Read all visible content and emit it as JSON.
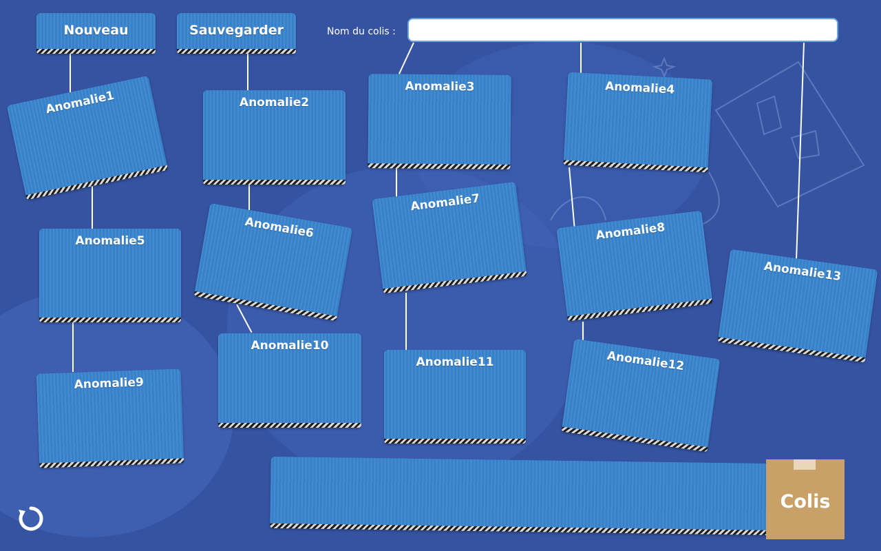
{
  "toolbar": {
    "new_label": "Nouveau",
    "save_label": "Sauvegarder"
  },
  "package_name": {
    "label": "Nom du colis :",
    "value": "",
    "placeholder": ""
  },
  "anomalies": [
    {
      "label": "Anomalie1"
    },
    {
      "label": "Anomalie2"
    },
    {
      "label": "Anomalie3"
    },
    {
      "label": "Anomalie4"
    },
    {
      "label": "Anomalie5"
    },
    {
      "label": "Anomalie6"
    },
    {
      "label": "Anomalie7"
    },
    {
      "label": "Anomalie8"
    },
    {
      "label": "Anomalie9"
    },
    {
      "label": "Anomalie10"
    },
    {
      "label": "Anomalie11"
    },
    {
      "label": "Anomalie12"
    },
    {
      "label": "Anomalie13"
    }
  ],
  "package": {
    "label": "Colis"
  },
  "icons": {
    "refresh": "refresh-icon"
  },
  "colors": {
    "background": "#3553a1",
    "cardboard": "#3a86d0",
    "package": "#c8a068"
  }
}
